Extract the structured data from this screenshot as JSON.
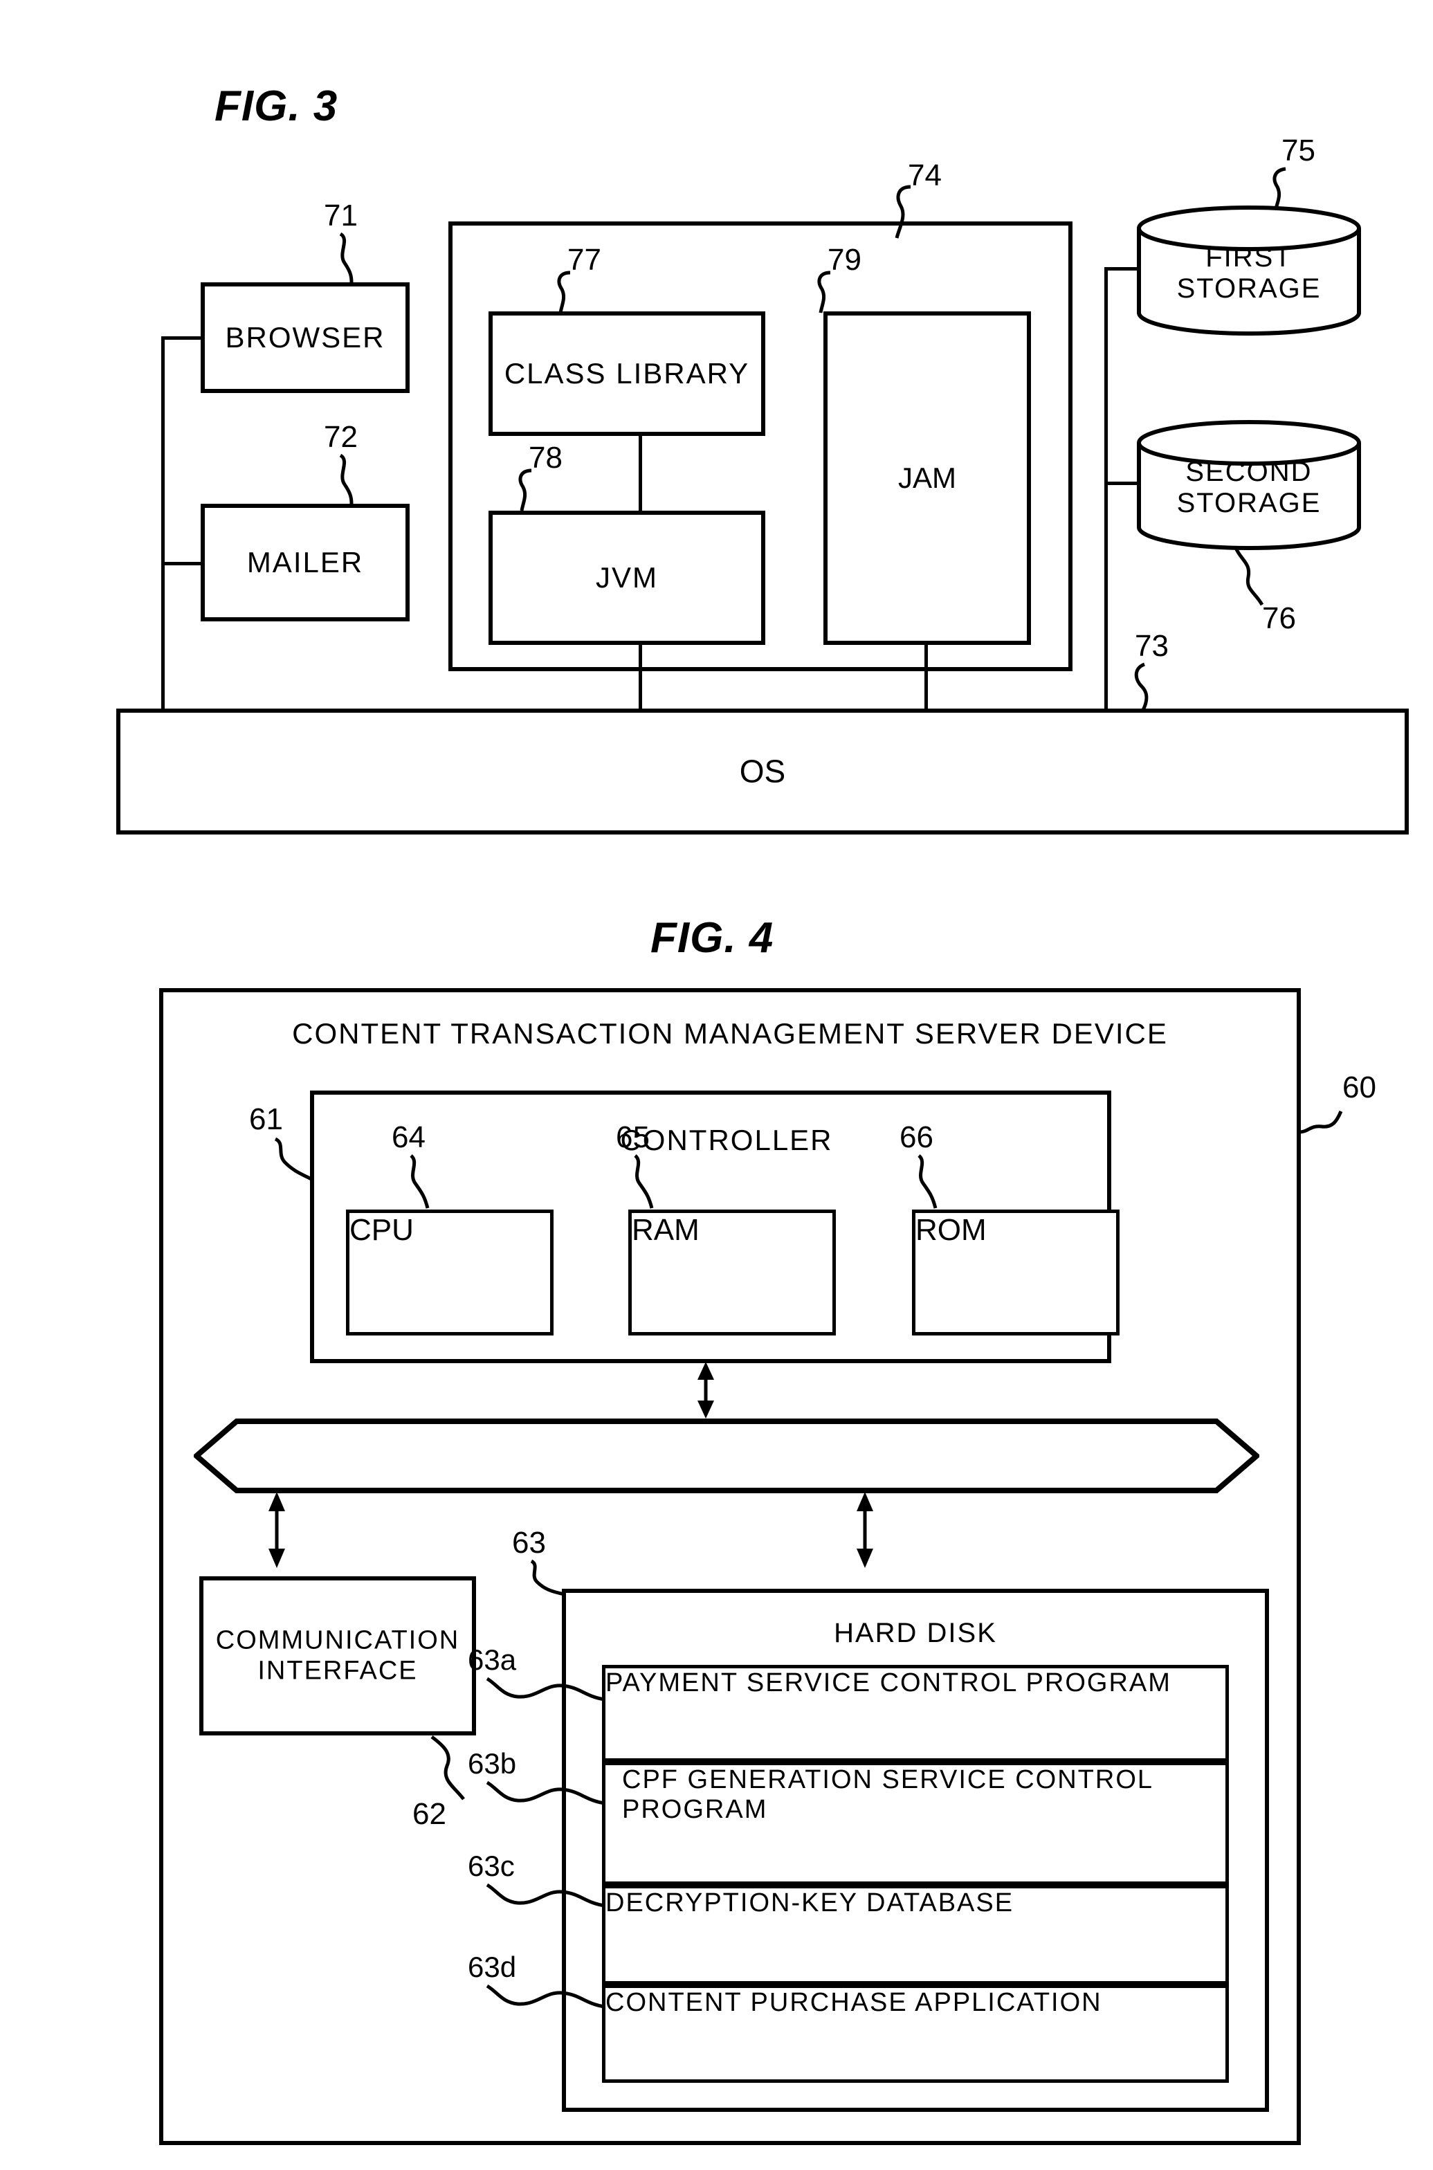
{
  "figure3": {
    "title": "FIG. 3",
    "blocks": {
      "browser": "BROWSER",
      "mailer": "MAILER",
      "class_library": "CLASS LIBRARY",
      "jvm": "JVM",
      "jam": "JAM",
      "os": "OS",
      "first_storage_line1": "FIRST",
      "first_storage_line2": "STORAGE",
      "second_storage_line1": "SECOND",
      "second_storage_line2": "STORAGE"
    },
    "reference_numerals": {
      "browser": "71",
      "mailer": "72",
      "os": "73",
      "platform_frame": "74",
      "first_storage": "75",
      "second_storage": "76",
      "class_library": "77",
      "jvm": "78",
      "jam": "79"
    }
  },
  "figure4": {
    "title": "FIG. 4",
    "device_title": "CONTENT TRANSACTION MANAGEMENT SERVER DEVICE",
    "controller_label": "CONTROLLER",
    "blocks": {
      "cpu": "CPU",
      "ram": "RAM",
      "rom": "ROM",
      "communication_interface_line1": "COMMUNICATION",
      "communication_interface_line2": "INTERFACE",
      "hard_disk": "HARD DISK"
    },
    "hard_disk_items": [
      "PAYMENT SERVICE CONTROL PROGRAM",
      "CPF GENERATION SERVICE CONTROL PROGRAM",
      "DECRYPTION-KEY DATABASE",
      "CONTENT PURCHASE APPLICATION"
    ],
    "reference_numerals": {
      "server_device": "60",
      "controller": "61",
      "communication_interface": "62",
      "hard_disk": "63",
      "payment_service_control_program": "63a",
      "cpf_generation_service_control_program": "63b",
      "decryption_key_database": "63c",
      "content_purchase_application": "63d",
      "cpu": "64",
      "ram": "65",
      "rom": "66"
    }
  }
}
